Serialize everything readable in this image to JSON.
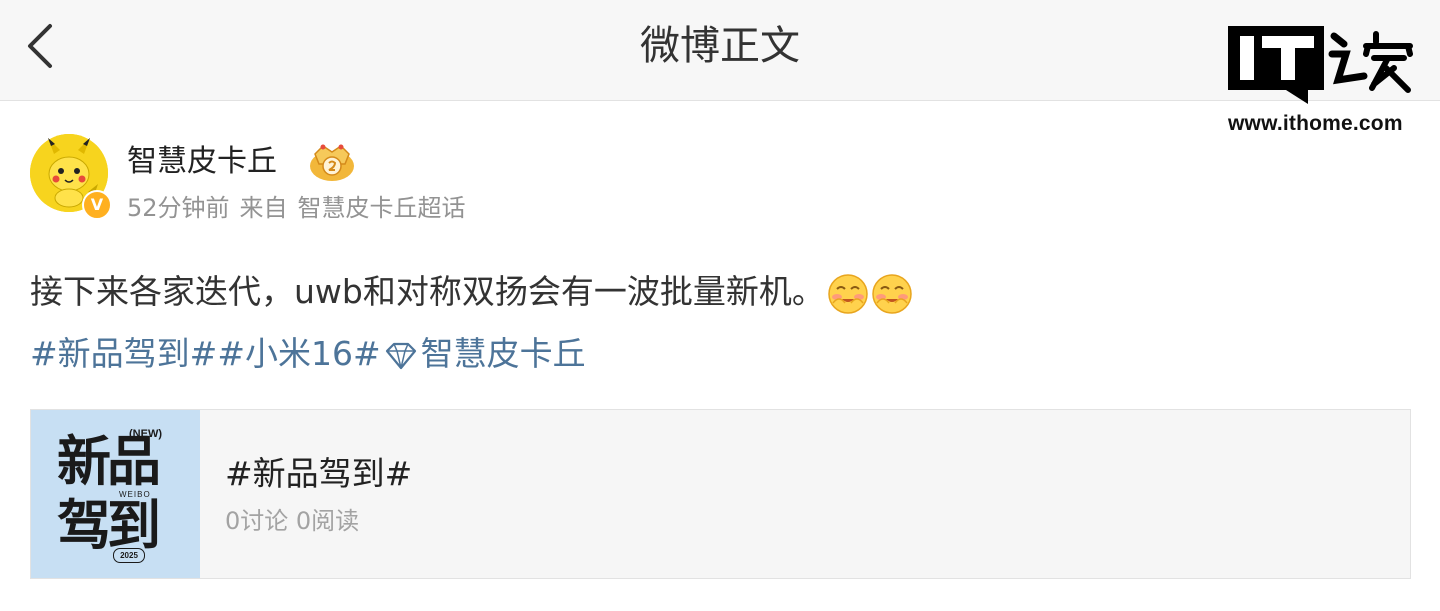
{
  "nav": {
    "back_icon": "chevron-left-icon",
    "title": "微博正文"
  },
  "watermark": {
    "logo_text": "IT之家",
    "url": "www.ithome.com"
  },
  "author": {
    "name": "智慧皮卡丘",
    "avatar_icon": "pikachu-avatar",
    "verified_badge": "V",
    "time": "52分钟前",
    "source_prefix": "来自",
    "source": "智慧皮卡丘超话"
  },
  "post": {
    "text": "接下来各家迭代，uwb和对称双扬会有一波批量新机。",
    "emojis": [
      "blush-emoji",
      "blush-emoji"
    ],
    "tag1": "#新品驾到#",
    "tag2": "#小米16#",
    "supertopic": "智慧皮卡丘"
  },
  "topic_card": {
    "thumb_line1": "新品",
    "thumb_line2": "驾到",
    "thumb_new": "(NEW)",
    "thumb_weibo": "WEIBO",
    "thumb_year": "2025",
    "title": "#新品驾到#",
    "stats": "0讨论 0阅读"
  },
  "colors": {
    "link": "#4d7499",
    "meta": "#939393",
    "nav_bg": "#f7f7f7",
    "card_bg": "#f6f6f6",
    "thumb_bg": "#c7dff3"
  }
}
